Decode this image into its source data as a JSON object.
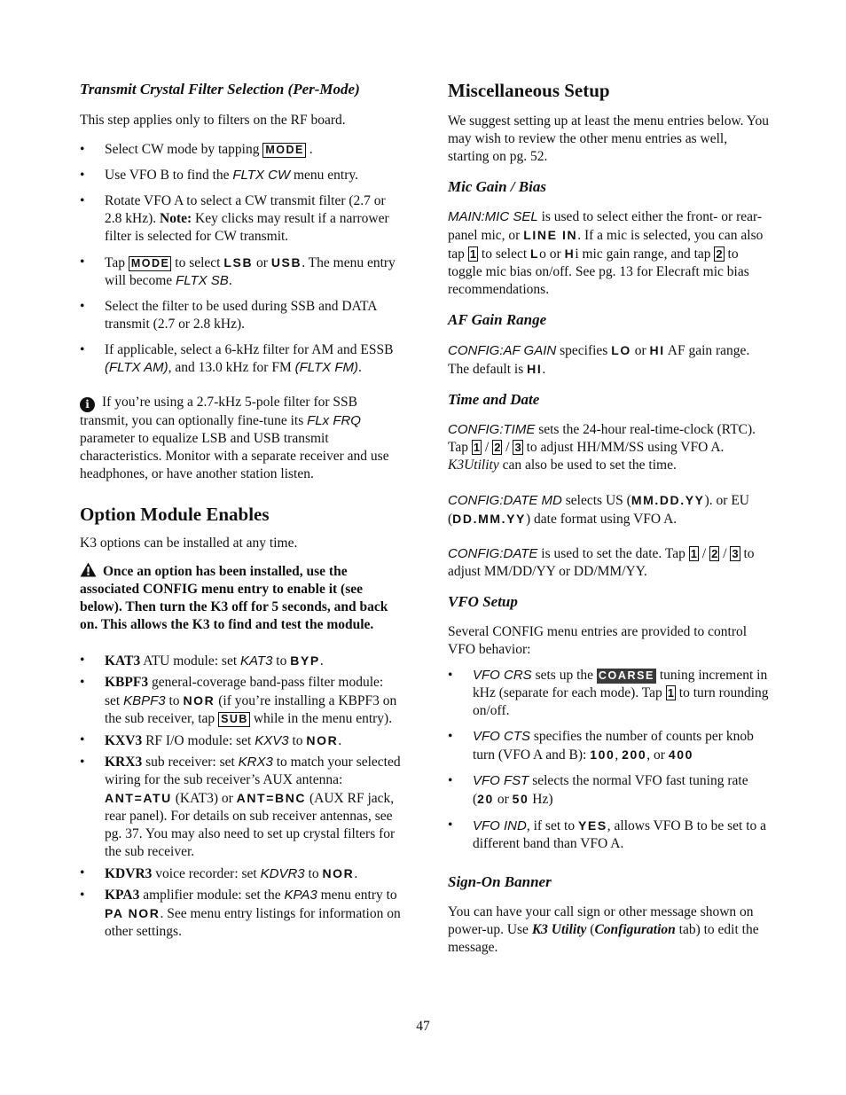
{
  "left": {
    "tx_filter": {
      "heading": "Transmit Crystal Filter Selection (Per-Mode)",
      "intro": "This step applies only to filters on the RF board.",
      "b1": {
        "pre": "Select CW mode by tapping ",
        "key": "MODE",
        "post": " ."
      },
      "b2": {
        "pre": "Use VFO B to find the ",
        "menu": "FLTX CW",
        "post": " menu entry."
      },
      "b3": {
        "pre": "Rotate VFO A to select a CW transmit filter (2.7 or 2.8 kHz).  ",
        "note_label": "Note:",
        "post": " Key clicks may result if a narrower filter is selected for CW transmit."
      },
      "b4": {
        "pre": "Tap ",
        "key": "MODE",
        "mid1": " to select ",
        "disp1": "LSB",
        "mid2": " or ",
        "disp2": "USB",
        "mid3": ". The menu entry will become ",
        "menu": "FLTX SB",
        "post": "."
      },
      "b5": {
        "text": "Select the filter to be used during SSB and DATA transmit (2.7 or 2.8 kHz)."
      },
      "b6": {
        "pre": "If applicable, select a 6-kHz filter for AM and ESSB ",
        "menu1": "(FLTX AM)",
        "mid": ", and 13.0 kHz for FM ",
        "menu2": "(FLTX FM)",
        "post": "."
      },
      "info_note": {
        "icon": "info-icon",
        "pre": "If you’re using a 2.7-kHz 5-pole filter for SSB transmit, you can optionally fine-tune its ",
        "menu": "FLx FRQ",
        "post": " parameter to equalize LSB and USB transmit characteristics. Monitor with a separate receiver and use headphones, or have another station listen."
      }
    },
    "option_modules": {
      "heading": "Option Module Enables",
      "intro": "K3 options can be installed at any time.",
      "warning": {
        "icon": "warning-icon",
        "text": "Once an option has been installed, use the associated CONFIG menu entry to enable it (see below). Then turn the K3 off for 5 seconds, and back on. This allows the K3 to find and test the module."
      },
      "kat3": {
        "name": "KAT3",
        "pre": " ATU module: set ",
        "menu": "KAT3",
        "mid": " to ",
        "disp": "BYP",
        "post": "."
      },
      "kbpf3": {
        "name": "KBPF3",
        "pre": " general-coverage band-pass filter module: set ",
        "menu": "KBPF3",
        "mid": " to ",
        "disp": "NOR",
        "mid2": " (if you’re installing a KBPF3 on the sub receiver, tap ",
        "key": "SUB",
        "post": " while in the menu entry)."
      },
      "kxv3": {
        "name": "KXV3",
        "pre": " RF I/O module: set ",
        "menu": "KXV3",
        "mid": " to ",
        "disp": "NOR",
        "post": "."
      },
      "krx3": {
        "name": "KRX3",
        "pre": " sub receiver: set ",
        "menu": "KRX3",
        "mid": " to match your selected wiring for the sub receiver’s AUX antenna: ",
        "disp1": "ANT=ATU",
        "mid2": " (KAT3) or ",
        "disp2": "ANT=BNC",
        "post": " (AUX RF jack, rear panel). For details on sub receiver antennas, see pg. 37. You may also need to set up crystal filters for the sub receiver."
      },
      "kdvr3": {
        "name": "KDVR3",
        "pre": " voice recorder: set ",
        "menu": "KDVR3",
        "mid": " to ",
        "disp": "NOR",
        "post": "."
      },
      "kpa3": {
        "name": "KPA3",
        "pre": " amplifier module: set the ",
        "menu": "KPA3",
        "mid": "  menu entry to ",
        "disp": "PA NOR",
        "post": ". See menu entry listings for information on other settings."
      }
    }
  },
  "right": {
    "misc": {
      "heading": "Miscellaneous Setup",
      "intro": "We suggest setting up at least the menu entries below. You may wish to review the other menu entries as well, starting on pg. 52."
    },
    "mic": {
      "heading": "Mic Gain / Bias",
      "menu": "MAIN:MIC SEL",
      "t1": " is used to select either the front- or rear-panel mic, or ",
      "disp1": "LINE IN",
      "t2": ". If a mic is selected, you can also tap ",
      "key1": "1",
      "t3": " to select ",
      "disp_lo": "L",
      "t_lo": "o or ",
      "disp_hi": "H",
      "t_hi": "i mic gain range, and tap ",
      "key2": "2",
      "t4": " to toggle mic bias on/off. See pg. 13 for Elecraft mic bias recommendations."
    },
    "af": {
      "heading": "AF Gain Range",
      "menu": "CONFIG:AF GAIN",
      "t1": " specifies ",
      "disp1": "LO",
      "t2": " or ",
      "disp2": "HI",
      "t3": " AF gain range. The default is ",
      "disp3": "HI",
      "t4": "."
    },
    "time": {
      "heading": "Time and Date",
      "p1": {
        "menu": "CONFIG:TIME",
        "t1": " sets the 24-hour real-time-clock (RTC). Tap ",
        "k1": "1",
        "sep1": " / ",
        "k2": "2",
        "sep2": " / ",
        "k3": "3",
        "t2": " to adjust HH/MM/SS using VFO A. ",
        "app": "K3Utility",
        "t3": " can also be used to set the time."
      },
      "p2": {
        "menu": "CONFIG:DATE MD",
        "t1": " selects US (",
        "disp1": "MM.DD.YY",
        "t2": "). or EU (",
        "disp2": "DD.MM.YY",
        "t3": ") date format using VFO A."
      },
      "p3": {
        "menu": "CONFIG:DATE",
        "t1": " is used to set the date. Tap ",
        "k1": "1",
        "sep1": " / ",
        "k2": "2",
        "sep2": " / ",
        "k3": "3",
        "t2": " to adjust MM/DD/YY or DD/MM/YY."
      }
    },
    "vfo": {
      "heading": "VFO Setup",
      "intro": "Several CONFIG menu entries are provided to control VFO behavior:",
      "crs": {
        "menu": "VFO CRS",
        "t1": " sets up the ",
        "key": "COARSE",
        "t2": " tuning increment in kHz (separate for each mode). Tap ",
        "k1": "1",
        "t3": " to turn rounding on/off."
      },
      "cts": {
        "menu": "VFO CTS",
        "t1": " specifies the number of counts per knob turn (VFO A and B): ",
        "d1": "100",
        "s1": ", ",
        "d2": "200",
        "s2": ", or ",
        "d3": "400"
      },
      "fst": {
        "menu": "VFO FST",
        "t1": " selects the normal VFO fast tuning rate (",
        "d1": "20",
        "s1": " or ",
        "d2": "50",
        "t2": " Hz)"
      },
      "ind": {
        "menu": "VFO IND",
        "t1": ", if set to ",
        "d1": "YES",
        "t2": ", allows VFO B to be set to a different band than VFO A."
      }
    },
    "banner": {
      "heading": "Sign-On Banner",
      "t1": "You can have your call sign or other message shown on power-up. Use ",
      "app": "K3 Utility",
      "t2": " (",
      "tab": "Configuration",
      "t3": " tab) to edit the message."
    }
  },
  "footer": {
    "page_number": "47"
  }
}
